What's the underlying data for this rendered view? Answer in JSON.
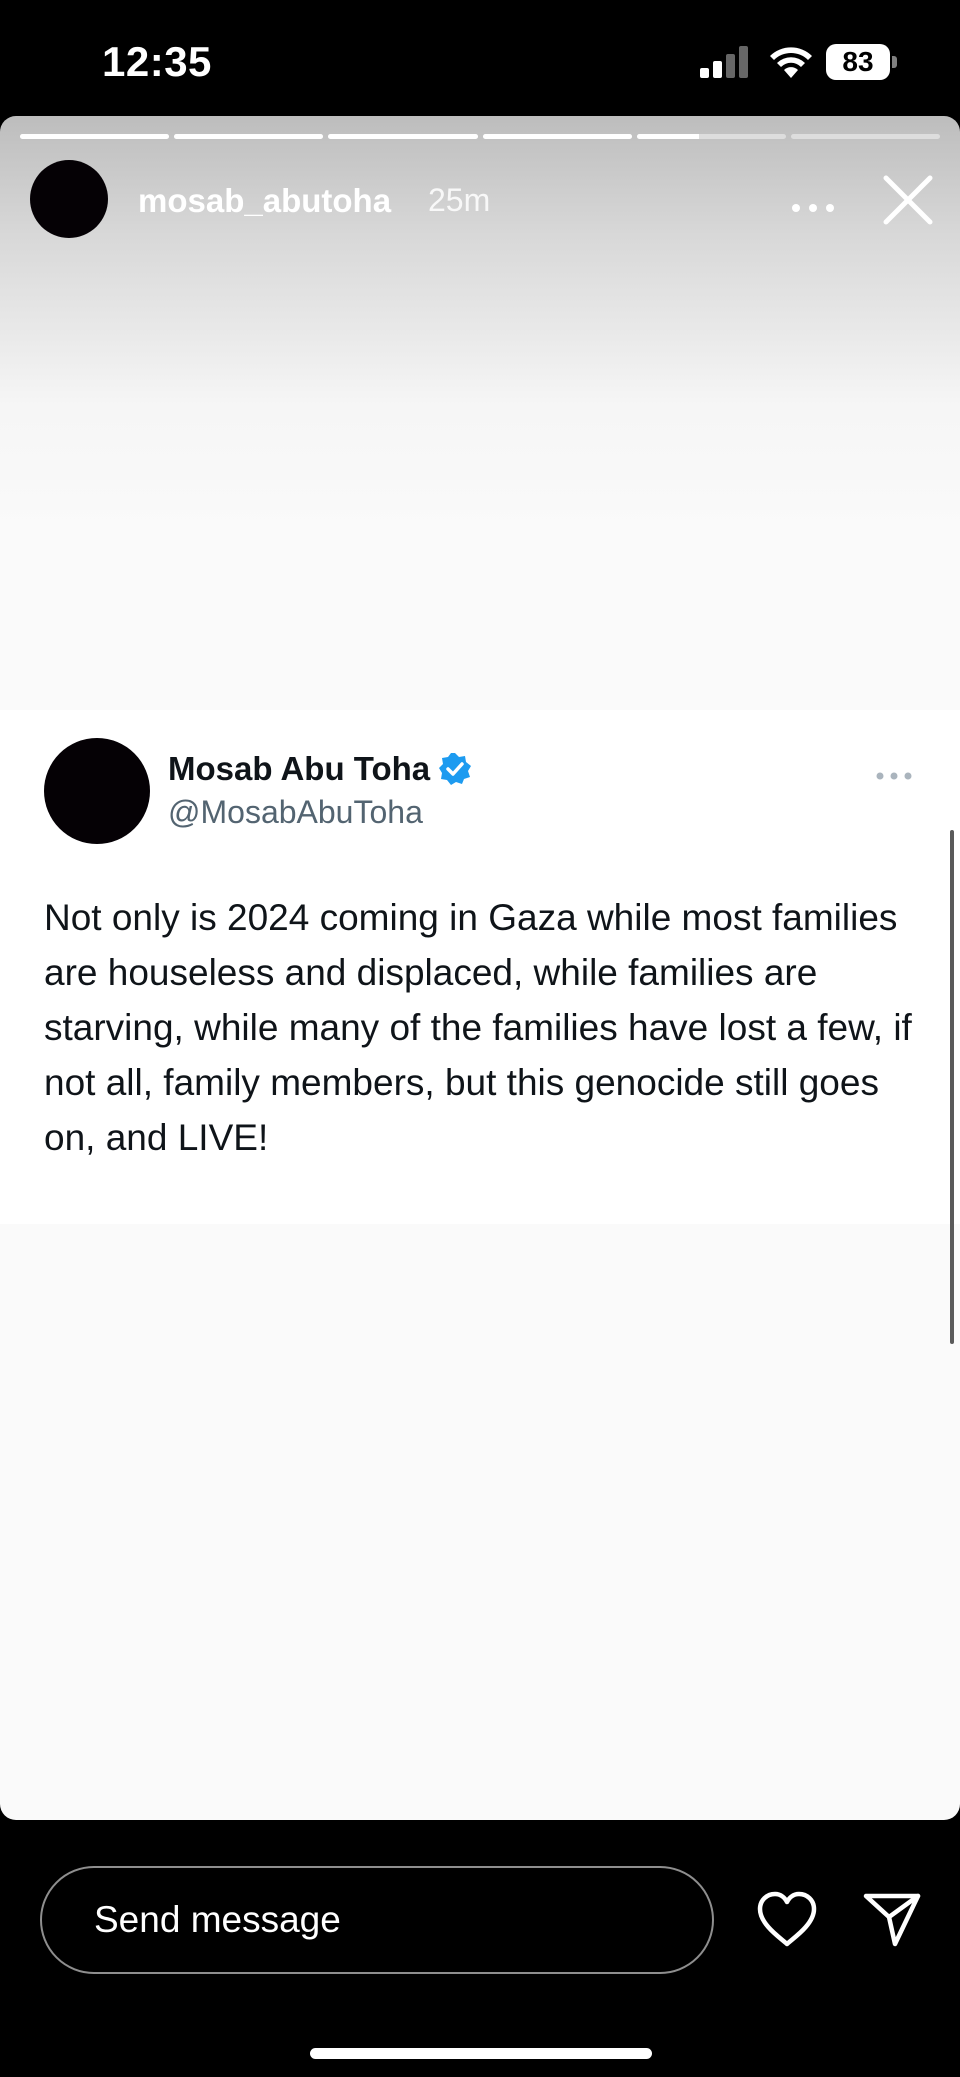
{
  "status_bar": {
    "time": "12:35",
    "battery": "83",
    "icons": [
      "cellular-signal-icon",
      "wifi-icon",
      "battery-icon"
    ]
  },
  "story": {
    "username": "mosab_abutoha",
    "time_ago": "25m",
    "segment_count": 6,
    "segment_progress": [
      1,
      1,
      1,
      1,
      0.42,
      0
    ],
    "icons": [
      "more-icon",
      "close-icon"
    ]
  },
  "tweet": {
    "display_name": "Mosab Abu Toha",
    "handle": "@MosabAbuToha",
    "text": "Not only is 2024 coming in Gaza while most families are houseless and displaced, while families are starving, while many of the families have lost a few, if not all, family members, but this genocide still goes on, and LIVE!",
    "verified_color": "#1d9bf0",
    "icons": [
      "verified-badge-icon",
      "more-icon"
    ]
  },
  "bottom_bar": {
    "send_placeholder": "Send message",
    "icons": [
      "heart-icon",
      "send-icon"
    ]
  }
}
